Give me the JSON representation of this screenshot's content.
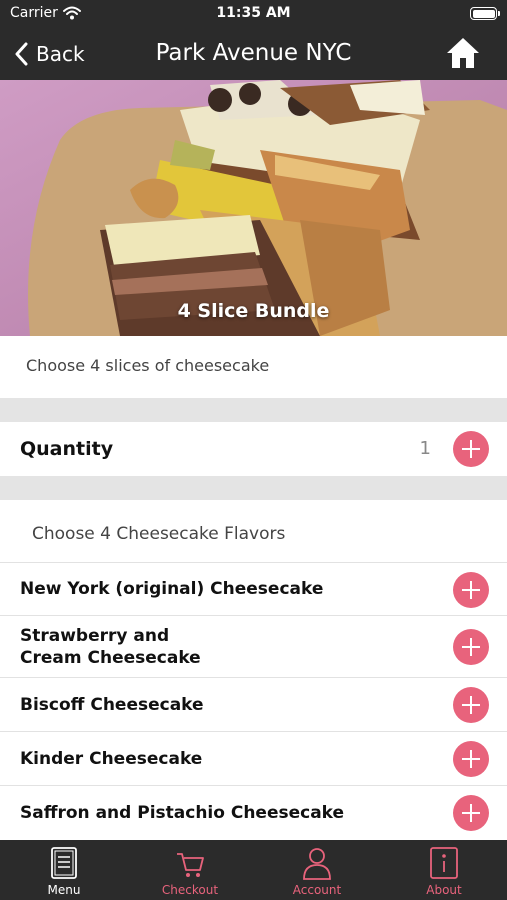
{
  "status_bar": {
    "carrier": "Carrier",
    "time": "11:35 AM",
    "wifi_icon": "wifi-icon",
    "battery_icon": "battery-icon",
    "battery_level": 1.0
  },
  "nav": {
    "back_label": "Back",
    "title": "Park Avenue NYC",
    "back_icon": "chevron-left-icon",
    "home_icon": "home-icon"
  },
  "hero": {
    "caption": "4 Slice Bundle"
  },
  "description": "Choose 4 slices of cheesecake",
  "quantity": {
    "label": "Quantity",
    "value": "1",
    "button_icon": "plus-icon"
  },
  "flavors": {
    "header": "Choose 4 Cheesecake Flavors",
    "items": [
      {
        "name": "New York (original) Cheesecake"
      },
      {
        "name": "Strawberry and\nCream Cheesecake"
      },
      {
        "name": "Biscoff Cheesecake"
      },
      {
        "name": "Kinder Cheesecake"
      },
      {
        "name": "Saffron and Pistachio Cheesecake"
      }
    ]
  },
  "tabs": [
    {
      "label": "Menu",
      "icon": "menu-icon",
      "active": true
    },
    {
      "label": "Checkout",
      "icon": "cart-icon",
      "active": false
    },
    {
      "label": "Account",
      "icon": "account-icon",
      "active": false
    },
    {
      "label": "About",
      "icon": "info-icon",
      "active": false
    }
  ],
  "colors": {
    "accent": "#e8637c",
    "bar_background": "#2b2b2b",
    "divider": "#e4e4e4",
    "inactive_tab": "#e8637c",
    "active_tab": "#ffffff"
  }
}
